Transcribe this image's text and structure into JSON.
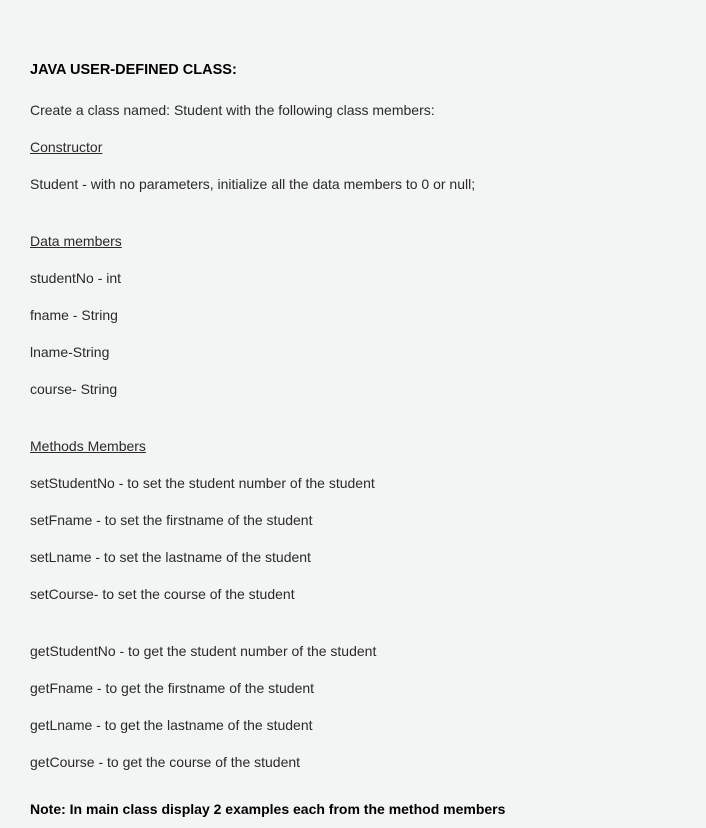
{
  "title": "JAVA USER-DEFINED CLASS:",
  "intro": "Create a class named: Student with the following class members:",
  "constructor": {
    "heading": "Constructor",
    "line": "Student - with no parameters, initialize all the data members to 0 or null;"
  },
  "dataMembers": {
    "heading": "Data members",
    "items": [
      "studentNo - int",
      "fname - String",
      "lname-String",
      "course- String"
    ]
  },
  "methods": {
    "heading": "Methods Members",
    "setters": [
      "setStudentNo - to set the student number of the student",
      "setFname - to set the firstname of the student",
      "setLname - to set the lastname of the student",
      "setCourse- to set the course of the student"
    ],
    "getters": [
      "getStudentNo - to get the student  number of the student",
      "getFname - to get the firstname of the student",
      "getLname - to get the lastname of the student",
      "getCourse - to get the course of the student"
    ]
  },
  "note": "Note: In main class  display 2 examples each from the method members"
}
